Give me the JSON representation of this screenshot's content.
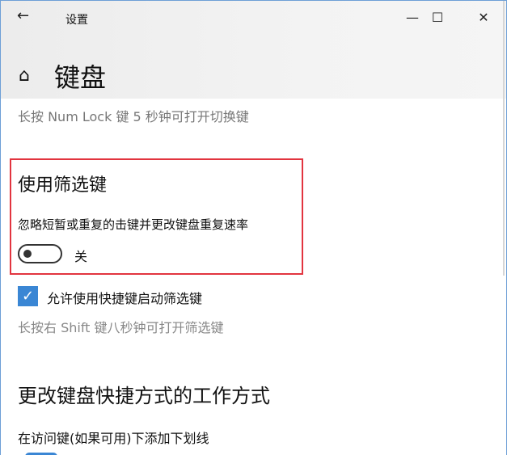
{
  "window": {
    "title": "设置",
    "minimize": "—",
    "maximize": "☐",
    "close": "✕",
    "back": "←"
  },
  "page": {
    "title": "键盘",
    "home_icon": "⌂"
  },
  "toggle_keys_hint": "长按 Num Lock 键 5 秒钟可打开切换键",
  "filter_keys": {
    "heading": "使用筛选键",
    "description": "忽略短暂或重复的击键并更改键盘重复速率",
    "toggle_state": "关",
    "toggle_on": false
  },
  "shortcut": {
    "checkbox_label": "允许使用快捷键启动筛选键",
    "checked": true,
    "check_glyph": "✓",
    "hint": "长按右 Shift 键八秒钟可打开筛选键"
  },
  "shortcuts_section": {
    "heading": "更改键盘快捷方式的工作方式",
    "underline_label": "在访问键(如果可用)下添加下划线"
  },
  "colors": {
    "accent": "#3a86d4",
    "highlight": "#e2343f"
  }
}
